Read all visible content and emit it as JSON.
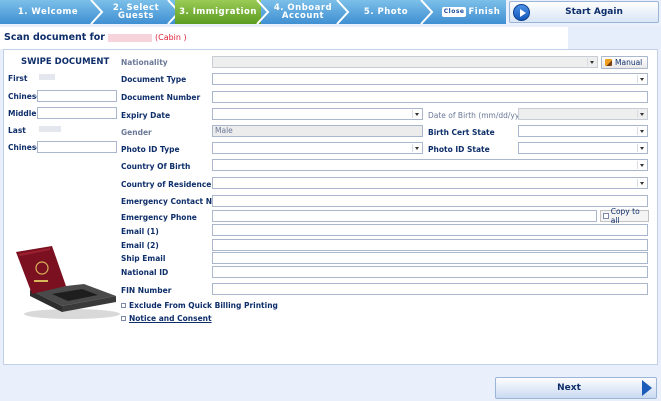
{
  "wizard": {
    "steps": [
      {
        "label": "1. Welcome"
      },
      {
        "label_line1": "2. Select",
        "label_line2": "Guests"
      },
      {
        "label": "3. Immigration"
      },
      {
        "label_line1": "4. Onboard",
        "label_line2": "Account"
      },
      {
        "label": "5. Photo"
      },
      {
        "badge": "Close",
        "label": "Finish"
      }
    ],
    "active_step": 3,
    "colors": {
      "bar": "#3f8fd2",
      "active": "#5c9c22"
    }
  },
  "start_again": {
    "label": "Start Again"
  },
  "header": {
    "scan_prefix": "Scan document for",
    "cabin": "(Cabin )"
  },
  "swipe": {
    "title": "SWIPE DOCUMENT",
    "first_label": "First",
    "chinese1_label": "Chinese",
    "middle_label": "Middle",
    "last_label": "Last",
    "chinese2_label": "Chinese"
  },
  "form": {
    "nationality": "Nationality",
    "manual": "Manual",
    "document_type": "Document Type",
    "document_number": "Document Number",
    "expiry_date": "Expiry Date",
    "date_of_birth": "Date of Birth (mm/dd/yy)",
    "gender": "Gender",
    "gender_value": "Male",
    "birth_cert_state": "Birth Cert State",
    "photo_id_type": "Photo ID Type",
    "photo_id_state": "Photo ID State",
    "country_of_birth": "Country Of Birth",
    "country_of_residence": "Country of Residence",
    "emergency_contact_name": "Emergency Contact Name",
    "emergency_phone": "Emergency Phone",
    "copy_to_all": "Copy to all",
    "email1": "Email (1)",
    "email2": "Email (2)",
    "ship_email": "Ship Email",
    "national_id": "National ID",
    "fin_number": "FIN Number",
    "exclude_billing": "Exclude From Quick Billing Printing",
    "notice_consent": "Notice and Consent"
  },
  "next": {
    "label": "Next"
  }
}
